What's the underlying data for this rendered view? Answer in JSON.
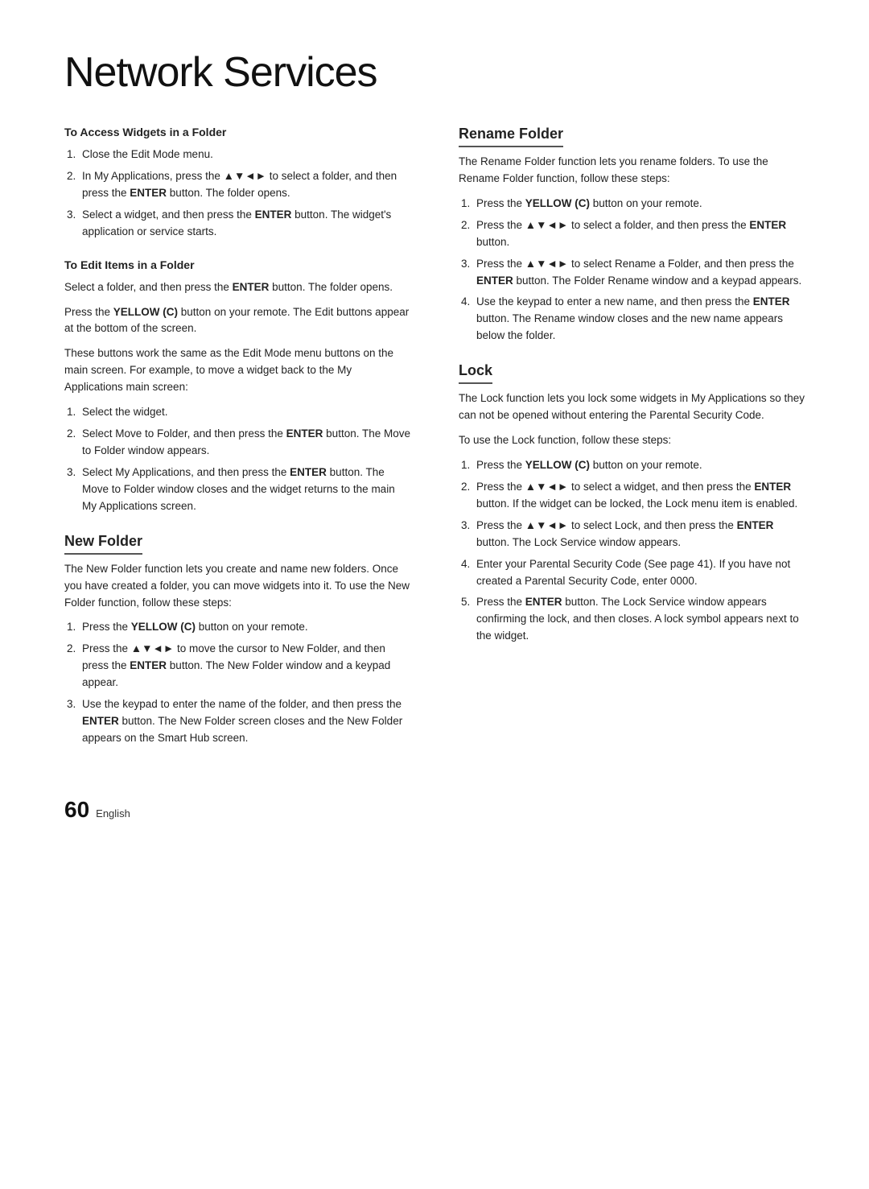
{
  "page": {
    "title": "Network Services",
    "page_number": "60",
    "language": "English"
  },
  "left_col": {
    "access_widgets": {
      "heading": "To Access Widgets in a Folder",
      "steps": [
        "Close the Edit Mode menu.",
        "In My Applications, press the ▲▼◄► to select a folder, and then press the ENTER button. The folder opens.",
        "Select a widget, and then press the ENTER button. The widget's application or service starts."
      ]
    },
    "edit_items": {
      "heading": "To Edit Items in a Folder",
      "para1": "Select a folder, and then press the ENTER button. The folder opens.",
      "para2": "Press the YELLOW (C) button on your remote. The Edit buttons appear at the bottom of the screen.",
      "para3": "These buttons work the same as the Edit Mode menu buttons on the main screen. For example, to move a widget back to the My Applications main screen:",
      "steps": [
        "Select the widget.",
        "Select Move to Folder, and then press the ENTER button. The Move to Folder window appears.",
        "Select My Applications, and then press the ENTER button. The Move to Folder window closes and the widget returns to the main My Applications screen."
      ]
    },
    "new_folder": {
      "heading": "New Folder",
      "intro": "The New Folder function lets you create and name new folders. Once you have created a folder, you can move widgets into it. To use the New Folder function, follow these steps:",
      "steps": [
        "Press the YELLOW (C) button on your remote.",
        "Press the ▲▼◄► to move the cursor to New Folder, and then press the ENTER button. The New Folder window and a keypad appear.",
        "Use the keypad to enter the name of the folder, and then press the ENTER button. The New Folder screen closes and the New Folder appears on the Smart Hub screen."
      ]
    }
  },
  "right_col": {
    "rename_folder": {
      "heading": "Rename Folder",
      "intro": "The Rename Folder function lets you rename folders. To use the Rename Folder function, follow these steps:",
      "steps": [
        "Press the YELLOW (C) button on your remote.",
        "Press the ▲▼◄► to select a folder, and then press the ENTER button.",
        "Press the ▲▼◄► to select Rename a Folder, and then press the ENTER button. The Folder Rename window and a keypad appears.",
        "Use the keypad to enter a new name, and then press the ENTER button. The Rename window closes and the new name appears below the folder."
      ]
    },
    "lock": {
      "heading": "Lock",
      "para1": "The Lock function lets you lock some widgets in My Applications so they can not be opened without entering the Parental Security Code.",
      "para2": "To use the Lock function, follow these steps:",
      "steps": [
        "Press the YELLOW (C) button on your remote.",
        "Press the ▲▼◄► to select a widget, and then press the ENTER button. If the widget can be locked, the Lock menu item is enabled.",
        "Press the ▲▼◄► to select Lock, and then press the ENTER button. The Lock Service window appears.",
        "Enter your Parental Security Code (See page 41). If you have not created a Parental Security Code, enter 0000.",
        "Press the ENTER button. The Lock Service window appears confirming the lock, and then closes. A lock symbol appears next to the widget."
      ]
    }
  }
}
